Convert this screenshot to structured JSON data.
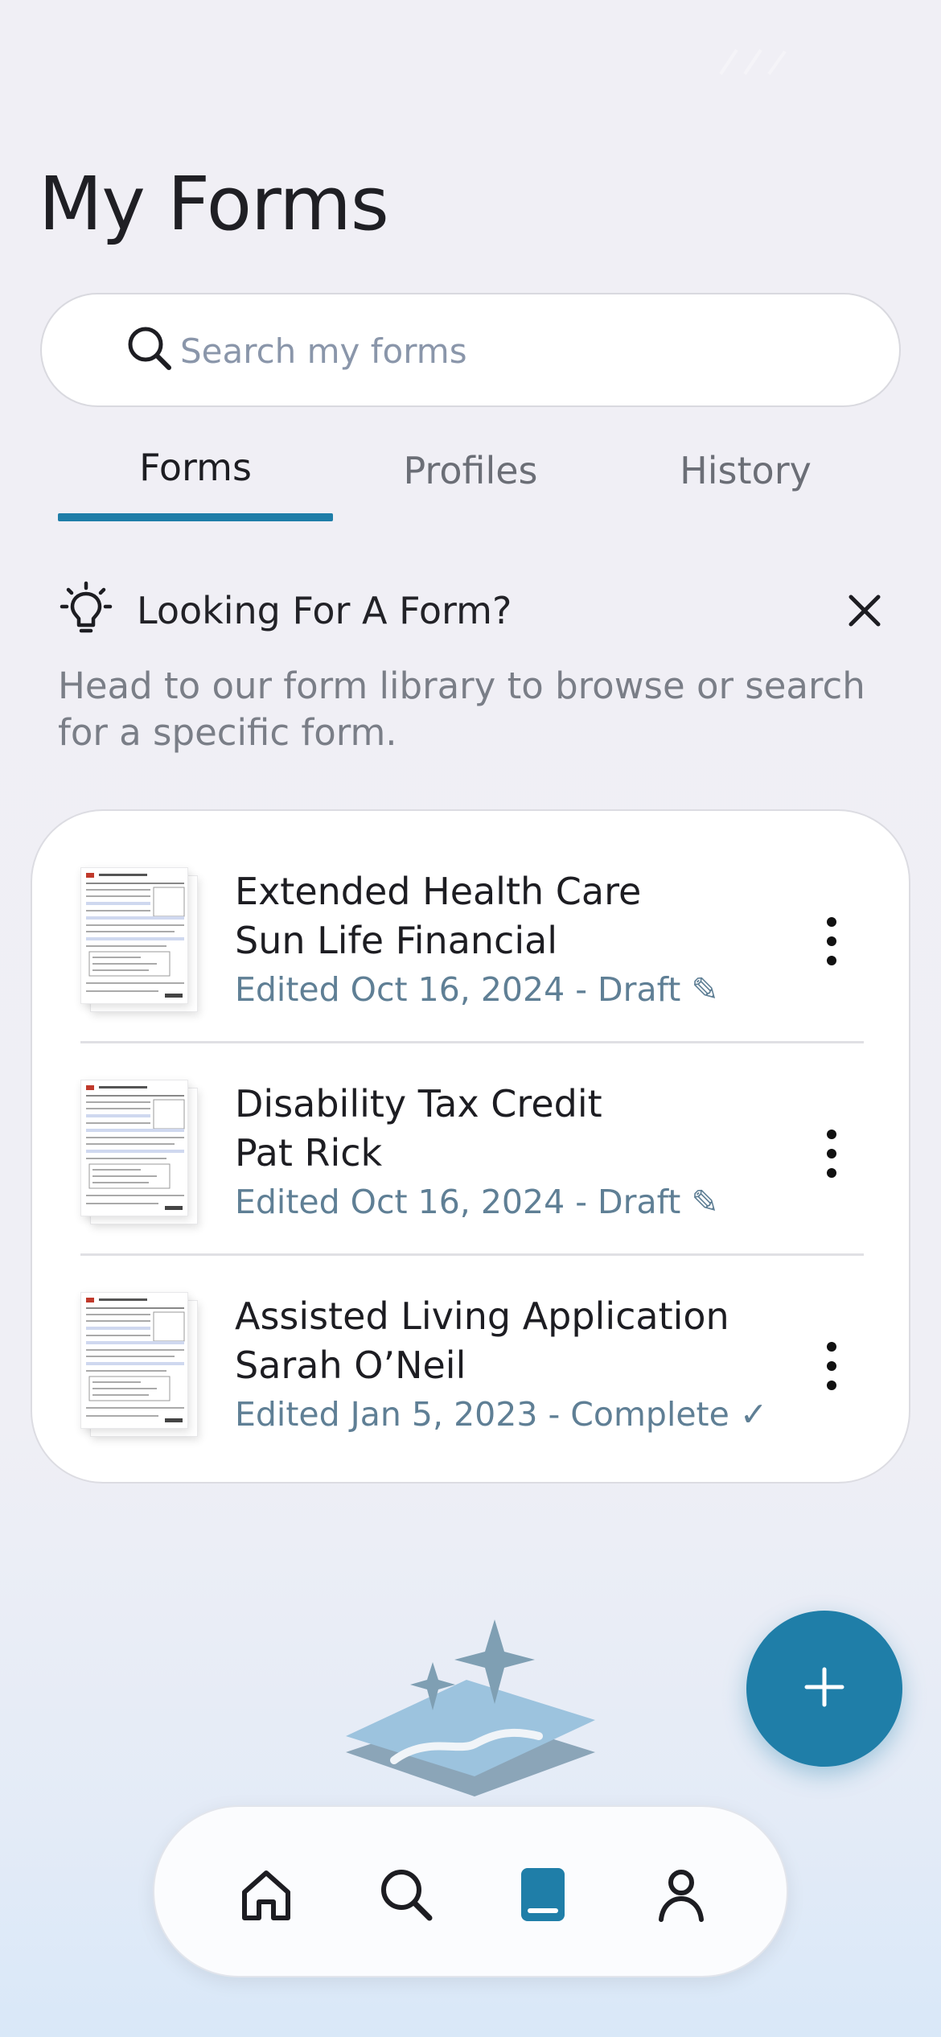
{
  "header": {
    "title": "My Forms"
  },
  "search": {
    "placeholder": "Search my forms",
    "icon": "search-icon"
  },
  "tabs": [
    {
      "label": "Forms",
      "active": true
    },
    {
      "label": "Profiles",
      "active": false
    },
    {
      "label": "History",
      "active": false
    }
  ],
  "tip": {
    "icon": "lightbulb-icon",
    "title": "Looking For A Form?",
    "text": "Head to our form library to browse or search for a specific form."
  },
  "forms": [
    {
      "title": "Extended Health Care",
      "subtitle": "Sun Life Financial",
      "meta": "Edited Oct 16, 2024 - Draft ✎",
      "status": "Draft"
    },
    {
      "title": "Disability Tax Credit",
      "subtitle": "Pat Rick",
      "meta": "Edited Oct 16, 2024 - Draft ✎",
      "status": "Draft"
    },
    {
      "title": "Assisted Living Application",
      "subtitle": "Sarah O’Neil",
      "meta": "Edited Jan 5, 2023 - Complete ✓",
      "status": "Complete"
    }
  ],
  "fab": {
    "icon": "plus-icon"
  },
  "bottom_nav": [
    {
      "icon": "home-icon",
      "active": false
    },
    {
      "icon": "search-icon",
      "active": false
    },
    {
      "icon": "book-icon",
      "active": true
    },
    {
      "icon": "person-icon",
      "active": false
    }
  ],
  "colors": {
    "accent": "#1f7ea8",
    "meta_text": "#5f7f95",
    "background": "#f0eff5"
  }
}
